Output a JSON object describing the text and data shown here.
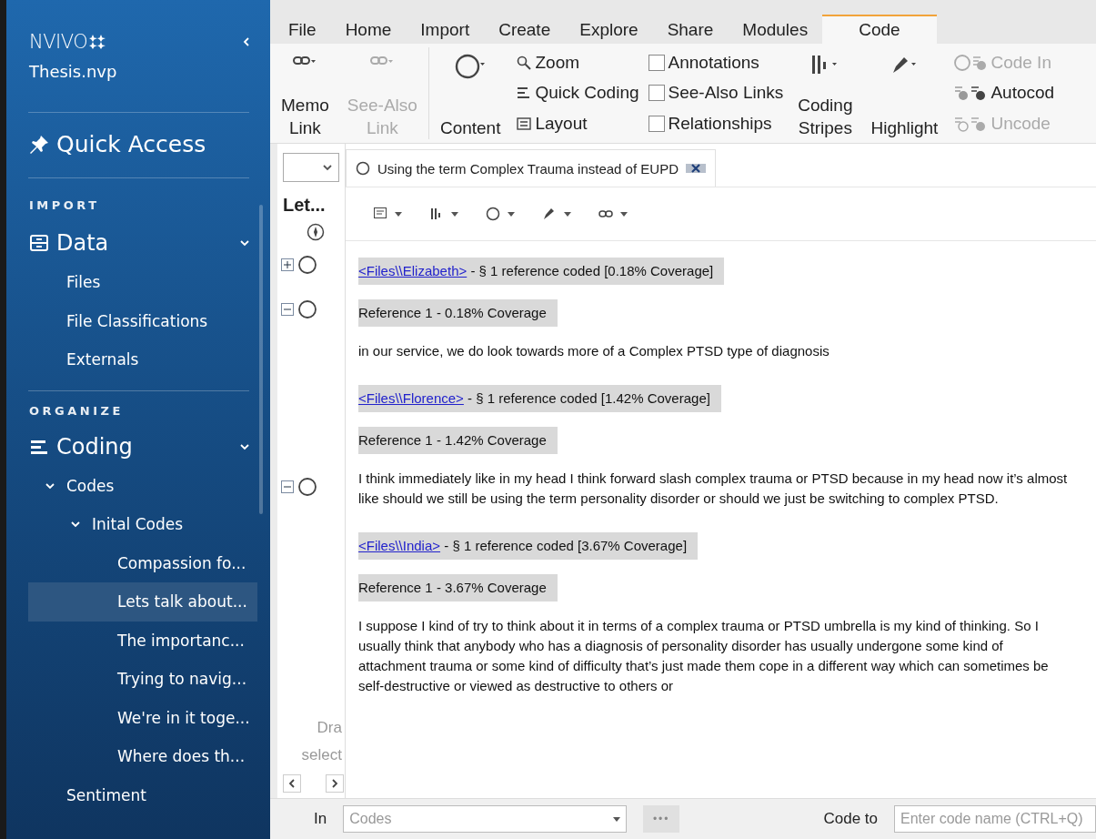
{
  "sidebar": {
    "logo": "NVIVO",
    "project": "Thesis.nvp",
    "quick_access": "Quick Access",
    "sections": [
      {
        "heading": "IMPORT",
        "group": {
          "label": "Data",
          "expanded": true,
          "tree": [
            {
              "label": "Files"
            },
            {
              "label": "File Classifications"
            },
            {
              "label": "Externals"
            }
          ]
        }
      },
      {
        "heading": "ORGANIZE",
        "group": {
          "label": "Coding",
          "expanded": true,
          "tree": [
            {
              "label": "Codes",
              "expanded": true,
              "children": [
                {
                  "label": "Inital Codes",
                  "expanded": true,
                  "children": [
                    {
                      "label": "Compassion fo...",
                      "selected": false
                    },
                    {
                      "label": "Lets talk about...",
                      "selected": true
                    },
                    {
                      "label": "The importanc...",
                      "selected": false
                    },
                    {
                      "label": "Trying to navig...",
                      "selected": false
                    },
                    {
                      "label": "We're in it toge...",
                      "selected": false
                    },
                    {
                      "label": "Where does th...",
                      "selected": false
                    }
                  ]
                }
              ]
            },
            {
              "label": "Sentiment"
            }
          ]
        }
      }
    ]
  },
  "ribbon_tabs": [
    {
      "label": "File",
      "selected": false
    },
    {
      "label": "Home",
      "selected": false
    },
    {
      "label": "Import",
      "selected": false
    },
    {
      "label": "Create",
      "selected": false
    },
    {
      "label": "Explore",
      "selected": false
    },
    {
      "label": "Share",
      "selected": false
    },
    {
      "label": "Modules",
      "selected": false
    },
    {
      "label": "Code",
      "selected": true
    }
  ],
  "ribbon": [
    {
      "kind": "large",
      "items": [
        {
          "lines": [
            "Memo",
            "Link"
          ],
          "disabled": false
        },
        {
          "lines": [
            "See-Also",
            "Link"
          ],
          "disabled": true
        }
      ]
    },
    {
      "kind": "large",
      "items": [
        {
          "lines": [
            "Content"
          ],
          "disabled": false
        }
      ]
    },
    {
      "kind": "small",
      "items": [
        {
          "label": "Zoom",
          "disabled": false
        },
        {
          "label": "Quick Coding",
          "disabled": false
        },
        {
          "label": "Layout",
          "disabled": false
        }
      ]
    },
    {
      "kind": "checks",
      "items": [
        {
          "label": "Annotations",
          "checked": false
        },
        {
          "label": "See-Also Links",
          "checked": false
        },
        {
          "label": "Relationships",
          "checked": false
        }
      ]
    },
    {
      "kind": "large",
      "items": [
        {
          "lines": [
            "Coding",
            "Stripes"
          ],
          "disabled": false
        },
        {
          "lines": [
            "Highlight"
          ],
          "disabled": false
        }
      ]
    },
    {
      "kind": "small",
      "items": [
        {
          "label": "Code In",
          "disabled": true
        },
        {
          "label": "Autocod",
          "disabled": false
        },
        {
          "label": "Uncode",
          "disabled": true
        }
      ]
    }
  ],
  "side_panel": {
    "title": "Let...",
    "hint": [
      "Dra",
      "select"
    ]
  },
  "document_tab": {
    "label": "Using the term Complex Trauma instead of EUPD"
  },
  "blocks": [
    {
      "kind": "file",
      "link": "<Files\\\\Elizabeth>",
      "text": " - § 1 reference coded  [0.18% Coverage]",
      "gutter": {
        "expanded": false
      }
    },
    {
      "kind": "reference",
      "text": "Reference 1 - 0.18% Coverage",
      "gutter": {
        "expanded": true
      }
    },
    {
      "kind": "passage",
      "text": "in our service, we do look towards more of a Complex PTSD type of diagnosis"
    },
    {
      "kind": "file",
      "link": "<Files\\\\Florence>",
      "text": " - § 1 reference coded  [1.42% Coverage]"
    },
    {
      "kind": "reference",
      "text": "Reference 1 - 1.42% Coverage"
    },
    {
      "kind": "passage",
      "text": "I think immediately like in my head I think forward slash complex trauma or PTSD because in my head now it’s almost like should we still be using the term personality disorder or should we just be switching to complex PTSD.",
      "gutter": {
        "expanded": true
      }
    },
    {
      "kind": "file",
      "link": "<Files\\\\India>",
      "text": " - § 1 reference coded  [3.67% Coverage]"
    },
    {
      "kind": "reference",
      "text": "Reference 1 - 3.67% Coverage"
    },
    {
      "kind": "passage",
      "text": "I suppose I kind of try to think about it in terms of a complex trauma or PTSD umbrella is my kind of thinking. So I usually think that anybody who has a diagnosis of personality disorder has usually undergone some kind of attachment trauma or some kind of difficulty that’s just made them cope in a different way which can sometimes be self-destructive or viewed as destructive to others or"
    }
  ],
  "bottom_bar": {
    "in_label": "In",
    "in_placeholder": "Codes",
    "more": "•••",
    "code_to_label": "Code to",
    "code_to_placeholder": "Enter code name (CTRL+Q)"
  }
}
